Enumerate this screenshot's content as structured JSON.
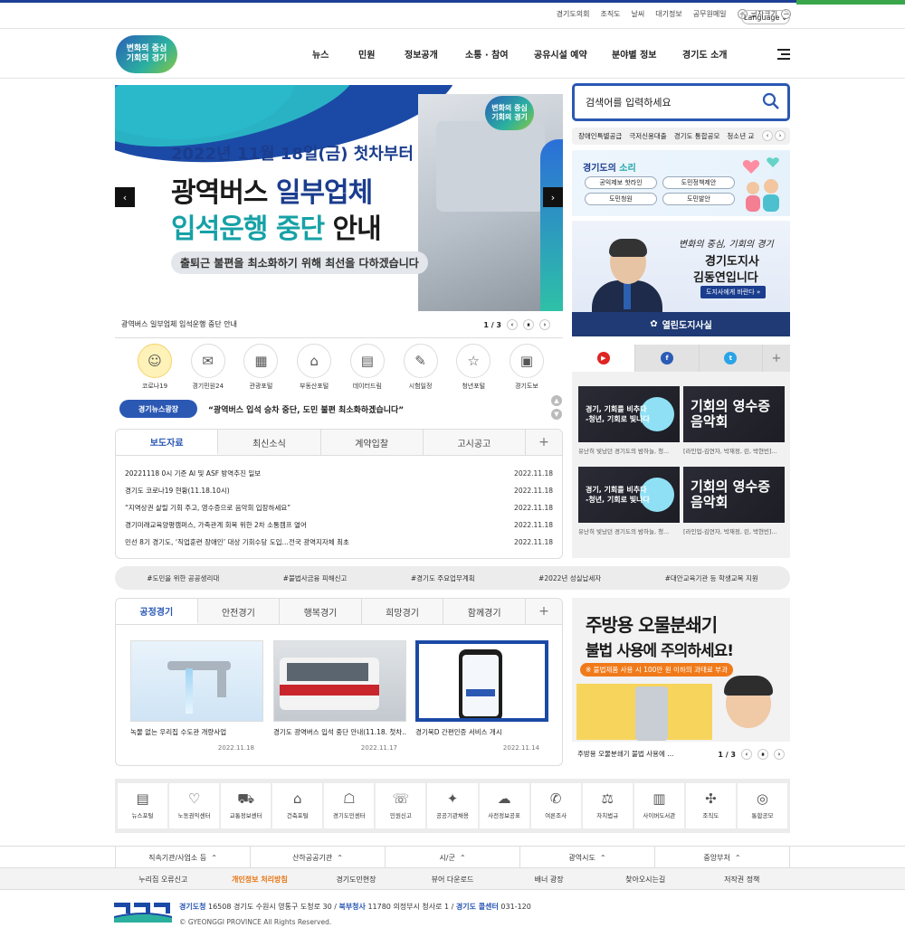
{
  "header": {
    "util_links": [
      "경기도의회",
      "조직도",
      "날씨",
      "대기정보",
      "공무원메일"
    ],
    "font_size_label": "글자크기",
    "font_plus": "+",
    "font_minus": "−",
    "language_label": "Language",
    "logo_line1": "변화의 중심",
    "logo_line2": "기회의 경기",
    "nav": [
      "뉴스",
      "민원",
      "정보공개",
      "소통 · 참여",
      "공유시설 예약",
      "분야별 정보",
      "경기도 소개"
    ]
  },
  "banner": {
    "logo_line1": "변화의 중심",
    "logo_line2": "기회의 경기",
    "line1": "2022년 11월 18일(금) 첫차부터",
    "line2_a": "광역버스 ",
    "line2_b": "일부업체",
    "line3_a": "입석운행 중단 ",
    "line3_b": "안내",
    "line4": "출퇴근 불편을 최소화하기 위해 최선을 다하겠습니다",
    "caption": "광역버스 일부업체 입석운행 중단 안내",
    "pager": "1 / 3",
    "prev": "‹",
    "next": "›",
    "pause": "⏸"
  },
  "quick_links": [
    {
      "label": "코로나19",
      "icon": "☺"
    },
    {
      "label": "경기민원24",
      "icon": "✉"
    },
    {
      "label": "관광포털",
      "icon": "▦"
    },
    {
      "label": "부동산포털",
      "icon": "⌂"
    },
    {
      "label": "데이터드림",
      "icon": "▤"
    },
    {
      "label": "시험일정",
      "icon": "✎"
    },
    {
      "label": "청년포털",
      "icon": "☆"
    },
    {
      "label": "경기도보",
      "icon": "▣"
    }
  ],
  "news_ticker": {
    "tag": "경기뉴스광장",
    "text": "“광역버스 입석 승차 중단, 도민 불편 최소화하겠습니다”"
  },
  "news_tabs": {
    "tabs": [
      "보도자료",
      "최신소식",
      "계약입찰",
      "고시공고"
    ],
    "plus": "+",
    "rows": [
      {
        "title": "20221118 0시 기준 AI 및 ASF 방역추진 일보",
        "date": "2022.11.18"
      },
      {
        "title": "경기도 코로나19 현황(11.18.10시)",
        "date": "2022.11.18"
      },
      {
        "title": "“지역상권 살릴 기회 주고, 영수증으로 음악회 입장하세요”",
        "date": "2022.11.18"
      },
      {
        "title": "경기미래교육양평캠퍼스, 가족관계 회복 위한 2차 소통캠프 열어",
        "date": "2022.11.18"
      },
      {
        "title": "민선 8기 경기도, ‘직업훈련 장애인’ 대상 기회수당 도입…전국 광역지자체 최초",
        "date": "2022.11.18"
      }
    ]
  },
  "search": {
    "placeholder": "검색어를 입력하세요",
    "keywords": [
      "장애인특별공급",
      "극저신용대출",
      "경기도 통합공모",
      "청소년 교"
    ],
    "prev": "‹",
    "next": "›"
  },
  "voice": {
    "title_a": "경기도의 ",
    "title_b": "소리",
    "pills": [
      "공익제보 핫라인",
      "도민정책제안",
      "도민청원",
      "도민발안"
    ]
  },
  "governor": {
    "slogan": "변화의 중심, 기회의 경기",
    "line1": "경기도지사",
    "line2": "김동연입니다",
    "button": "도지사에게 바란다 »",
    "footer": "열린도지사실"
  },
  "sns": {
    "tabs": [
      {
        "name": "youtube",
        "glyph": "▶",
        "color": "#e02424"
      },
      {
        "name": "facebook",
        "glyph": "f",
        "color": "#2b5bb5"
      },
      {
        "name": "twitter",
        "glyph": "t",
        "color": "#2aa3e8"
      }
    ],
    "plus": "+",
    "videos": [
      {
        "big": "경기, 기회를 비추다\n-청년, 기회로 빛나다",
        "caption": "유난히 빛났던 경기도의 밤하늘, 청..."
      },
      {
        "big": "기회의 영수증\n음악회",
        "caption": "[라인업-김연자, 박재정, 린, 박현빈]..."
      },
      {
        "big": "경기, 기회를 비추다\n-청년, 기회로 빛나다",
        "caption": "유난히 빛났던 경기도의 밤하늘, 청..."
      },
      {
        "big": "기회의 영수증\n음악회",
        "caption": "[라인업-김연자, 박재정, 린, 박현빈]..."
      }
    ]
  },
  "hashtags": [
    "#도민을 위한 공공생리대",
    "#불법사금융 피해신고",
    "#경기도 주요업무계획",
    "#2022년 성실납세자",
    "#대안교육기관 등 학생교복 지원"
  ],
  "theme_tabs": {
    "tabs": [
      "공정경기",
      "안전경기",
      "행복경기",
      "희망경기",
      "함께경기"
    ],
    "plus": "+",
    "cards": [
      {
        "caption": "녹물 없는 우리집 수도관 개량사업",
        "date": "2022.11.18"
      },
      {
        "caption": "경기도 광역버스 입석 중단 안내(11.18. 첫차...",
        "date": "2022.11.17"
      },
      {
        "caption": "경기북D 간편인증 서비스 개시",
        "date": "2022.11.14"
      }
    ]
  },
  "promo": {
    "line1": "주방용 오물분쇄기",
    "line2": "불법 사용에 주의하세요!",
    "line3": "※ 불법제품 사용 시 100만 원 이하의 과태료 부과",
    "caption": "주방용 오물분쇄기 불법 사용에 ...",
    "pager": "1 / 3"
  },
  "services": [
    {
      "label": "뉴스포털",
      "icon": "▤"
    },
    {
      "label": "노동권익센터",
      "icon": "♡"
    },
    {
      "label": "교통정보센터",
      "icon": "⛟"
    },
    {
      "label": "건축포털",
      "icon": "⌂"
    },
    {
      "label": "경기도민센터",
      "icon": "☖"
    },
    {
      "label": "민원신고",
      "icon": "☏"
    },
    {
      "label": "공공기관채용",
      "icon": "✦"
    },
    {
      "label": "사전정보공표",
      "icon": "☁"
    },
    {
      "label": "여론조사",
      "icon": "✆"
    },
    {
      "label": "자치법규",
      "icon": "⚖"
    },
    {
      "label": "사이버도서관",
      "icon": "▥"
    },
    {
      "label": "조직도",
      "icon": "✣"
    },
    {
      "label": "통합공모",
      "icon": "◎"
    }
  ],
  "footer": {
    "dropdowns": [
      "직속기관/사업소 등",
      "산하공공기관",
      "시/군",
      "광역시도",
      "중앙부처"
    ],
    "links": [
      "누리집 오류신고",
      "개인정보 처리방침",
      "경기도민현장",
      "뷰어 다운로드",
      "배너 광장",
      "찾아오시는길",
      "저작권 정책"
    ],
    "addr_org1": "경기도청",
    "addr1": " 16508 경기도 수원시 영통구 도청로 30 / ",
    "addr_org2": "북부청사",
    "addr2": " 11780 의정부시 청사로 1 / ",
    "addr_org3": "경기도 콜센터",
    "addr3": " 031-120",
    "copyright": "© GYEONGGI PROVINCE All Rights Reserved."
  }
}
